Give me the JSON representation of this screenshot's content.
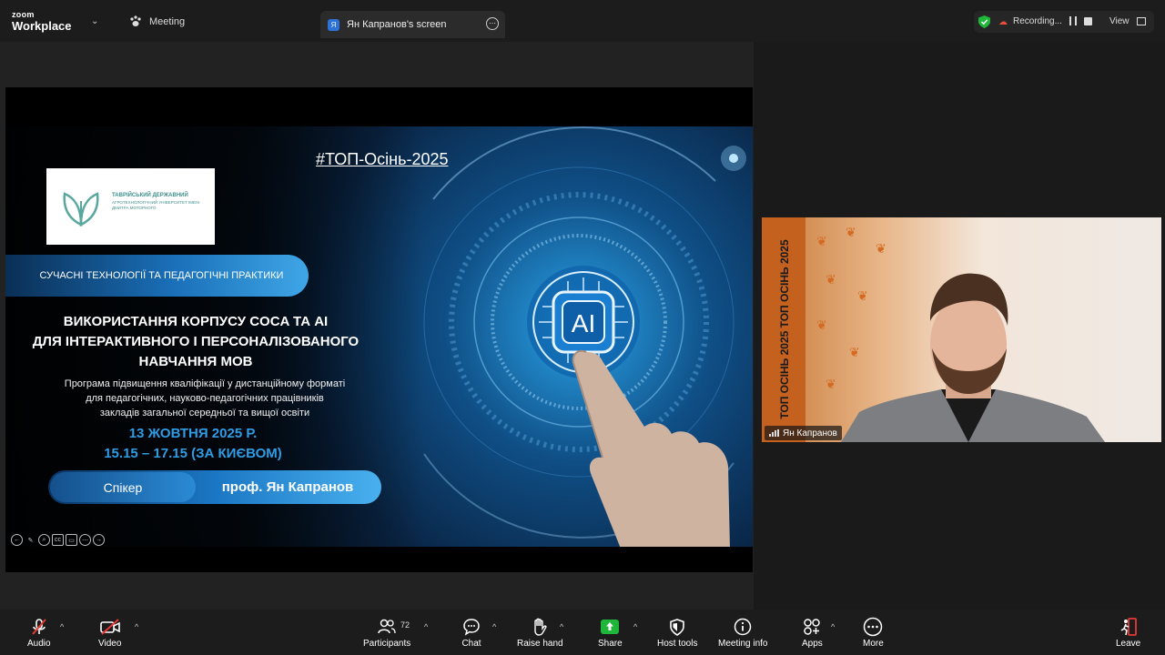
{
  "topbar": {
    "logo_top": "zoom",
    "logo_bottom": "Workplace",
    "meeting_label": "Meeting",
    "share_avatar": "Я",
    "share_label": "Ян Капранов's screen",
    "share_more": "⋯",
    "recording_label": "Recording...",
    "view_label": "View"
  },
  "slide": {
    "hashtag": "#ТОП-Осінь-2025",
    "university": "ТАВРІЙСЬКИЙ ДЕРЖАВНИЙ",
    "university_sub": "АГРОТЕХНОЛОГІЧНИЙ УНІВЕРСИТЕТ ІМЕНІ ДМИТРА МОТОРНОГО",
    "section": "СУЧАСНІ ТЕХНОЛОГІЇ ТА ПЕДАГОГІЧНІ ПРАКТИКИ",
    "title_line1": "ВИКОРИСТАННЯ КОРПУСУ COCA ТА AI",
    "title_line2": "ДЛЯ ІНТЕРАКТИВНОГО І ПЕРСОНАЛІЗОВАНОГО",
    "title_line3": "НАВЧАННЯ МОВ",
    "subtitle_line1": "Програма підвищення кваліфікації у дистанційному форматі",
    "subtitle_line2": "для педагогічних, науково-педагогічних працівників",
    "subtitle_line3": "закладів загальної середньої та вищої освіти",
    "date_line1": "13 ЖОВТНЯ 2025 Р.",
    "date_line2": "15.15 – 17.15 (ЗА КИЄВОМ)",
    "speaker_label": "Спікер",
    "speaker_name": "проф. Ян Капранов",
    "ai_text": "AI"
  },
  "video": {
    "banner_text": "ТОП ОСІНЬ 2025 ТОП ОСІНЬ 2025",
    "participant_name": "Ян Капранов"
  },
  "toolbar": {
    "audio": "Audio",
    "video": "Video",
    "participants": "Participants",
    "participants_count": "72",
    "chat": "Chat",
    "raise_hand": "Raise hand",
    "share": "Share",
    "host_tools": "Host tools",
    "meeting_info": "Meeting info",
    "apps": "Apps",
    "more": "More",
    "leave": "Leave"
  },
  "colors": {
    "accent_blue": "#2f9de6",
    "share_green": "#1fb73a",
    "leave_red": "#e53935",
    "banner_orange": "#c5611f"
  }
}
